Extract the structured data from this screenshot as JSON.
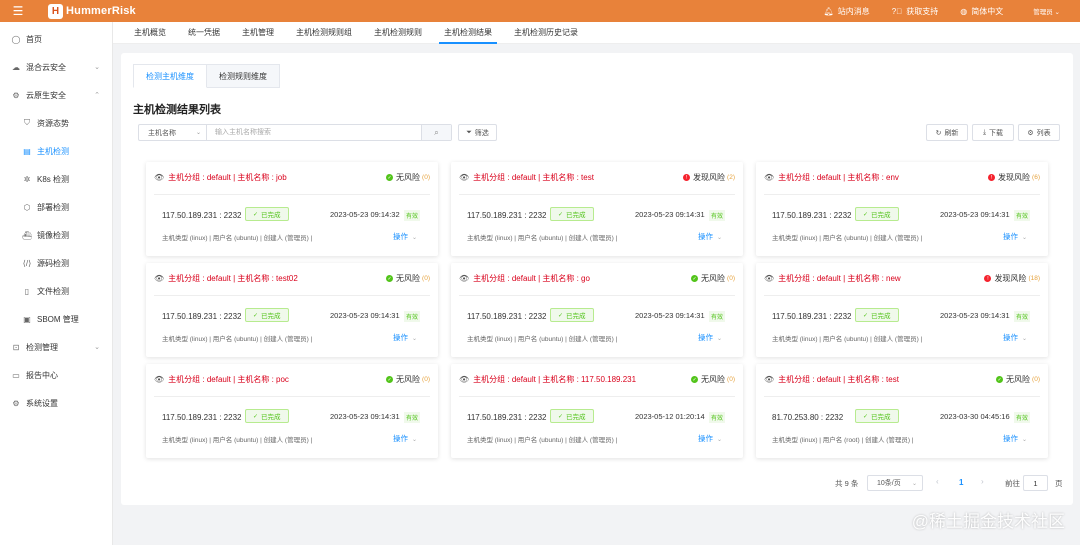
{
  "topbar": {
    "menu_icon": "hamburger-icon",
    "logo_mark": "H",
    "app_name": "HummerRisk",
    "links": [
      {
        "icon": "bell-icon",
        "label": "站内消息"
      },
      {
        "icon": "help-icon",
        "label": "获取支持"
      },
      {
        "icon": "globe-icon",
        "label": "简体中文"
      }
    ],
    "user": "管理员 ⌄"
  },
  "sidebar": {
    "items": [
      {
        "icon": "home-icon",
        "label": "首页"
      },
      {
        "icon": "cloud-icon",
        "label": "混合云安全"
      },
      {
        "icon": "cloud-native-icon",
        "label": "云原生安全"
      },
      {
        "icon": "shield-icon",
        "label": "资源态势"
      },
      {
        "icon": "host-icon",
        "label": "主机检测"
      },
      {
        "icon": "k8s-icon",
        "label": "K8s 检测"
      },
      {
        "icon": "deploy-icon",
        "label": "部署检测"
      },
      {
        "icon": "image-icon",
        "label": "镜像检测"
      },
      {
        "icon": "code-icon",
        "label": "源码检测"
      },
      {
        "icon": "file-icon",
        "label": "文件检测"
      },
      {
        "icon": "sbom-icon",
        "label": "SBOM 管理"
      },
      {
        "icon": "monitor-icon",
        "label": "检测管理"
      },
      {
        "icon": "report-icon",
        "label": "报告中心"
      },
      {
        "icon": "settings-icon",
        "label": "系统设置"
      }
    ]
  },
  "navtabs": [
    "主机概览",
    "统一凭据",
    "主机管理",
    "主机检测规则组",
    "主机检测规则",
    "主机检测结果",
    "主机检测历史记录"
  ],
  "subtabs": [
    "检测主机维度",
    "检测规则维度"
  ],
  "list_title": "主机检测结果列表",
  "search": {
    "select_label": "主机名称",
    "placeholder": "输入主机名称搜索"
  },
  "filter_label": "筛选",
  "toolbar": {
    "refresh": "刷新",
    "download": "下载",
    "columns": "列表"
  },
  "cards": [
    {
      "title": "主机分组 : default | 主机名称 : job",
      "risk": "无风险",
      "risk_count": "(0)",
      "risk_color": "#52c41a",
      "ip": "117.50.189.231 : 2232",
      "status": "已完成",
      "time": "2023-05-23 09:14:32",
      "valid": "有效",
      "meta": "主机类型 (linux) | 用户名 (ubuntu) | 创建人 (管理员) |",
      "op": "操作"
    },
    {
      "title": "主机分组 : default | 主机名称 : test",
      "risk": "发现风险",
      "risk_count": "(2)",
      "risk_color": "#f5222d",
      "ip": "117.50.189.231 : 2232",
      "status": "已完成",
      "time": "2023-05-23 09:14:31",
      "valid": "有效",
      "meta": "主机类型 (linux) | 用户名 (ubuntu) | 创建人 (管理员) |",
      "op": "操作"
    },
    {
      "title": "主机分组 : default | 主机名称 : env",
      "risk": "发现风险",
      "risk_count": "(6)",
      "risk_color": "#f5222d",
      "ip": "117.50.189.231 : 2232",
      "status": "已完成",
      "time": "2023-05-23 09:14:31",
      "valid": "有效",
      "meta": "主机类型 (linux) | 用户名 (ubuntu) | 创建人 (管理员) |",
      "op": "操作"
    },
    {
      "title": "主机分组 : default | 主机名称 : test02",
      "risk": "无风险",
      "risk_count": "(0)",
      "risk_color": "#52c41a",
      "ip": "117.50.189.231 : 2232",
      "status": "已完成",
      "time": "2023-05-23 09:14:31",
      "valid": "有效",
      "meta": "主机类型 (linux) | 用户名 (ubuntu) | 创建人 (管理员) |",
      "op": "操作"
    },
    {
      "title": "主机分组 : default | 主机名称 : go",
      "risk": "无风险",
      "risk_count": "(0)",
      "risk_color": "#52c41a",
      "ip": "117.50.189.231 : 2232",
      "status": "已完成",
      "time": "2023-05-23 09:14:31",
      "valid": "有效",
      "meta": "主机类型 (linux) | 用户名 (ubuntu) | 创建人 (管理员) |",
      "op": "操作"
    },
    {
      "title": "主机分组 : default | 主机名称 : new",
      "risk": "发现风险",
      "risk_count": "(18)",
      "risk_color": "#f5222d",
      "ip": "117.50.189.231 : 2232",
      "status": "已完成",
      "time": "2023-05-23 09:14:31",
      "valid": "有效",
      "meta": "主机类型 (linux) | 用户名 (ubuntu) | 创建人 (管理员) |",
      "op": "操作"
    },
    {
      "title": "主机分组 : default | 主机名称 : poc",
      "risk": "无风险",
      "risk_count": "(0)",
      "risk_color": "#52c41a",
      "ip": "117.50.189.231 : 2232",
      "status": "已完成",
      "time": "2023-05-23 09:14:31",
      "valid": "有效",
      "meta": "主机类型 (linux) | 用户名 (ubuntu) | 创建人 (管理员) |",
      "op": "操作"
    },
    {
      "title": "主机分组 : default | 主机名称 : 117.50.189.231",
      "risk": "无风险",
      "risk_count": "(0)",
      "risk_color": "#52c41a",
      "ip": "117.50.189.231 : 2232",
      "status": "已完成",
      "time": "2023-05-12 01:20:14",
      "valid": "有效",
      "meta": "主机类型 (linux) | 用户名 (ubuntu) | 创建人 (管理员) |",
      "op": "操作"
    },
    {
      "title": "主机分组 : default | 主机名称 : test",
      "risk": "无风险",
      "risk_count": "(0)",
      "risk_color": "#52c41a",
      "ip": "81.70.253.80 : 2232",
      "status": "已完成",
      "time": "2023-03-30 04:45:16",
      "valid": "有效",
      "meta": "主机类型 (linux) | 用户名 (root) | 创建人 (管理员) |",
      "op": "操作"
    }
  ],
  "pagination": {
    "total": "共 9 条",
    "page_size": "10条/页",
    "current": "1",
    "goto_label": "前往",
    "goto_value": "1",
    "page_unit": "页"
  },
  "watermark": "@稀土掘金技术社区"
}
